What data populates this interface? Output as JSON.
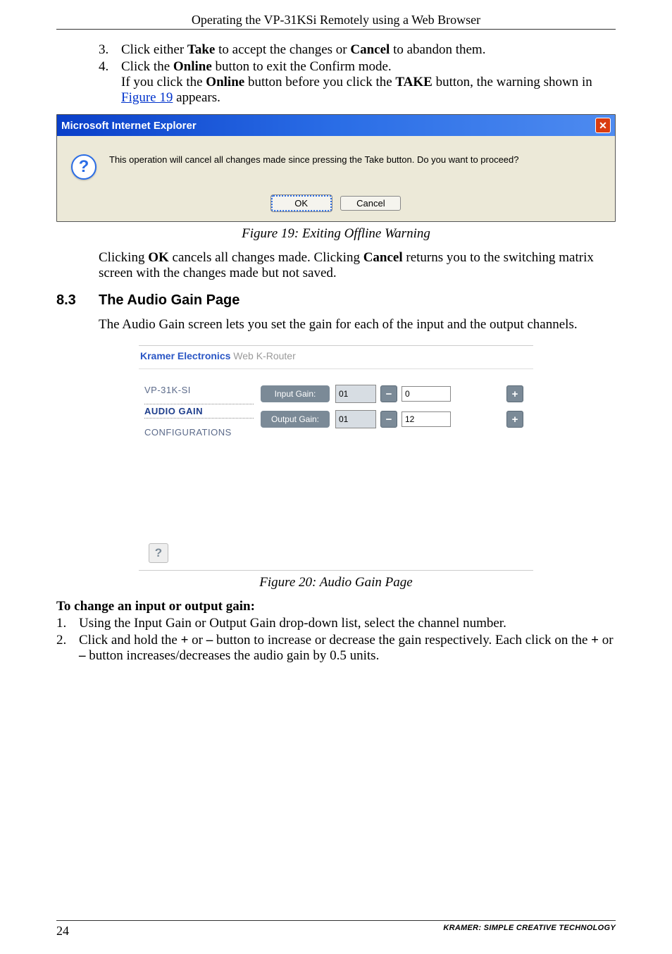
{
  "header_title": "Operating the VP-31KSi Remotely using a Web Browser",
  "step3": {
    "num": "3.",
    "pre": "Click either ",
    "b1": "Take",
    "mid": " to accept the changes or ",
    "b2": "Cancel",
    "post": " to abandon them."
  },
  "step4": {
    "num": "4.",
    "l1a": "Click the ",
    "l1b": "Online",
    "l1c": " button to exit the Confirm mode.",
    "l2a": "If you click the ",
    "l2b": "Online",
    "l2c": " button before you click the ",
    "l2d": "TAKE",
    "l2e": " button, the warning shown in ",
    "l2link": "Figure 19",
    "l2f": " appears."
  },
  "ie": {
    "title": "Microsoft Internet Explorer",
    "close_glyph": "✕",
    "q": "?",
    "msg": "This operation will cancel all changes made since pressing the Take button. Do you want to proceed?",
    "ok": "OK",
    "cancel": "Cancel"
  },
  "fig19": "Figure 19: Exiting Offline Warning",
  "para_after_fig": {
    "a": "Clicking ",
    "b1": "OK",
    "c": " cancels all changes made. Clicking ",
    "b2": "Cancel",
    "d": " returns you to the switching matrix screen with the changes made but not saved."
  },
  "section": {
    "num": "8.3",
    "title": "The Audio Gain Page"
  },
  "intro": "The Audio Gain screen lets you set the gain for each of the input and the output channels.",
  "kramer": {
    "brand": "Kramer Electronics",
    "sub": " Web K-Router",
    "nav1": "VP-31K-SI",
    "nav2": "AUDIO GAIN",
    "nav3": "CONFIGURATIONS",
    "input_label": "Input Gain:",
    "output_label": "Output Gain:",
    "input_sel": "01",
    "output_sel": "01",
    "minus": "−",
    "plus": "+",
    "input_val": "0",
    "output_val": "12",
    "help": "?"
  },
  "fig20": "Figure 20: Audio Gain Page",
  "proc_head": "To change an input or output gain:",
  "p1": {
    "num": "1.",
    "text": "Using the Input Gain or Output Gain drop-down list, select the channel number."
  },
  "p2": {
    "num": "2.",
    "a": "Click and hold the ",
    "plus": "+",
    "b": " or ",
    "minus": "–",
    "c": " button to increase or decrease the gain respectively. Each click on the ",
    "plus2": "+",
    "d": " or ",
    "minus2": "–",
    "e": " button increases/decreases the audio gain by 0.5 units."
  },
  "footer": {
    "page": "24",
    "text": "KRAMER:  SIMPLE CREATIVE TECHNOLOGY"
  }
}
